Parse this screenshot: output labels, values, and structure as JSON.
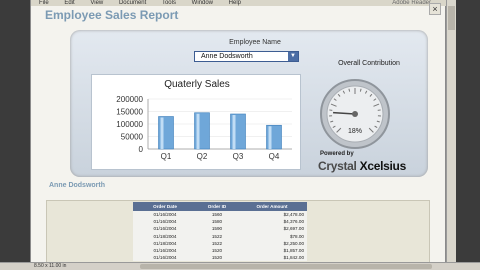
{
  "menubar": {
    "items": [
      "File",
      "Edit",
      "View",
      "Document",
      "Tools",
      "Window",
      "Help"
    ],
    "right": "Adobe Reader"
  },
  "report": {
    "title": "Employee Sales Report",
    "close": "×"
  },
  "selector": {
    "label": "Employee Name",
    "value": "Anne Dodsworth",
    "arrow": "▼"
  },
  "gauge": {
    "label": "Overall Contribution",
    "value_label": "18%",
    "value": 0.18
  },
  "branding": {
    "powered": "Powered by",
    "brand1": "Crystal",
    "brand2": "Xcelsius"
  },
  "section": {
    "name": "Anne Dodsworth"
  },
  "table": {
    "headers": [
      "Order Date",
      "Order ID",
      "Order Amount"
    ],
    "rows": [
      [
        "01/16/2004",
        "1560",
        "$2,478.00"
      ],
      [
        "01/16/2004",
        "1580",
        "$4,376.00"
      ],
      [
        "01/16/2004",
        "1590",
        "$2,697.00"
      ],
      [
        "01/18/2004",
        "1522",
        "$78.00"
      ],
      [
        "01/18/2004",
        "1522",
        "$2,250.00"
      ],
      [
        "01/16/2004",
        "1520",
        "$1,857.00"
      ],
      [
        "01/16/2004",
        "1520",
        "$1,842.00"
      ]
    ]
  },
  "status": {
    "page_size": "8.50 x 11.00 in"
  },
  "chart_data": {
    "type": "bar",
    "title": "Quaterly Sales",
    "categories": [
      "Q1",
      "Q2",
      "Q3",
      "Q4"
    ],
    "values": [
      130000,
      145000,
      140000,
      95000
    ],
    "yticks": [
      "200000",
      "150000",
      "100000",
      "50000",
      "0"
    ],
    "ylim": [
      0,
      200000
    ],
    "bar_color": "#6fa7d9"
  }
}
